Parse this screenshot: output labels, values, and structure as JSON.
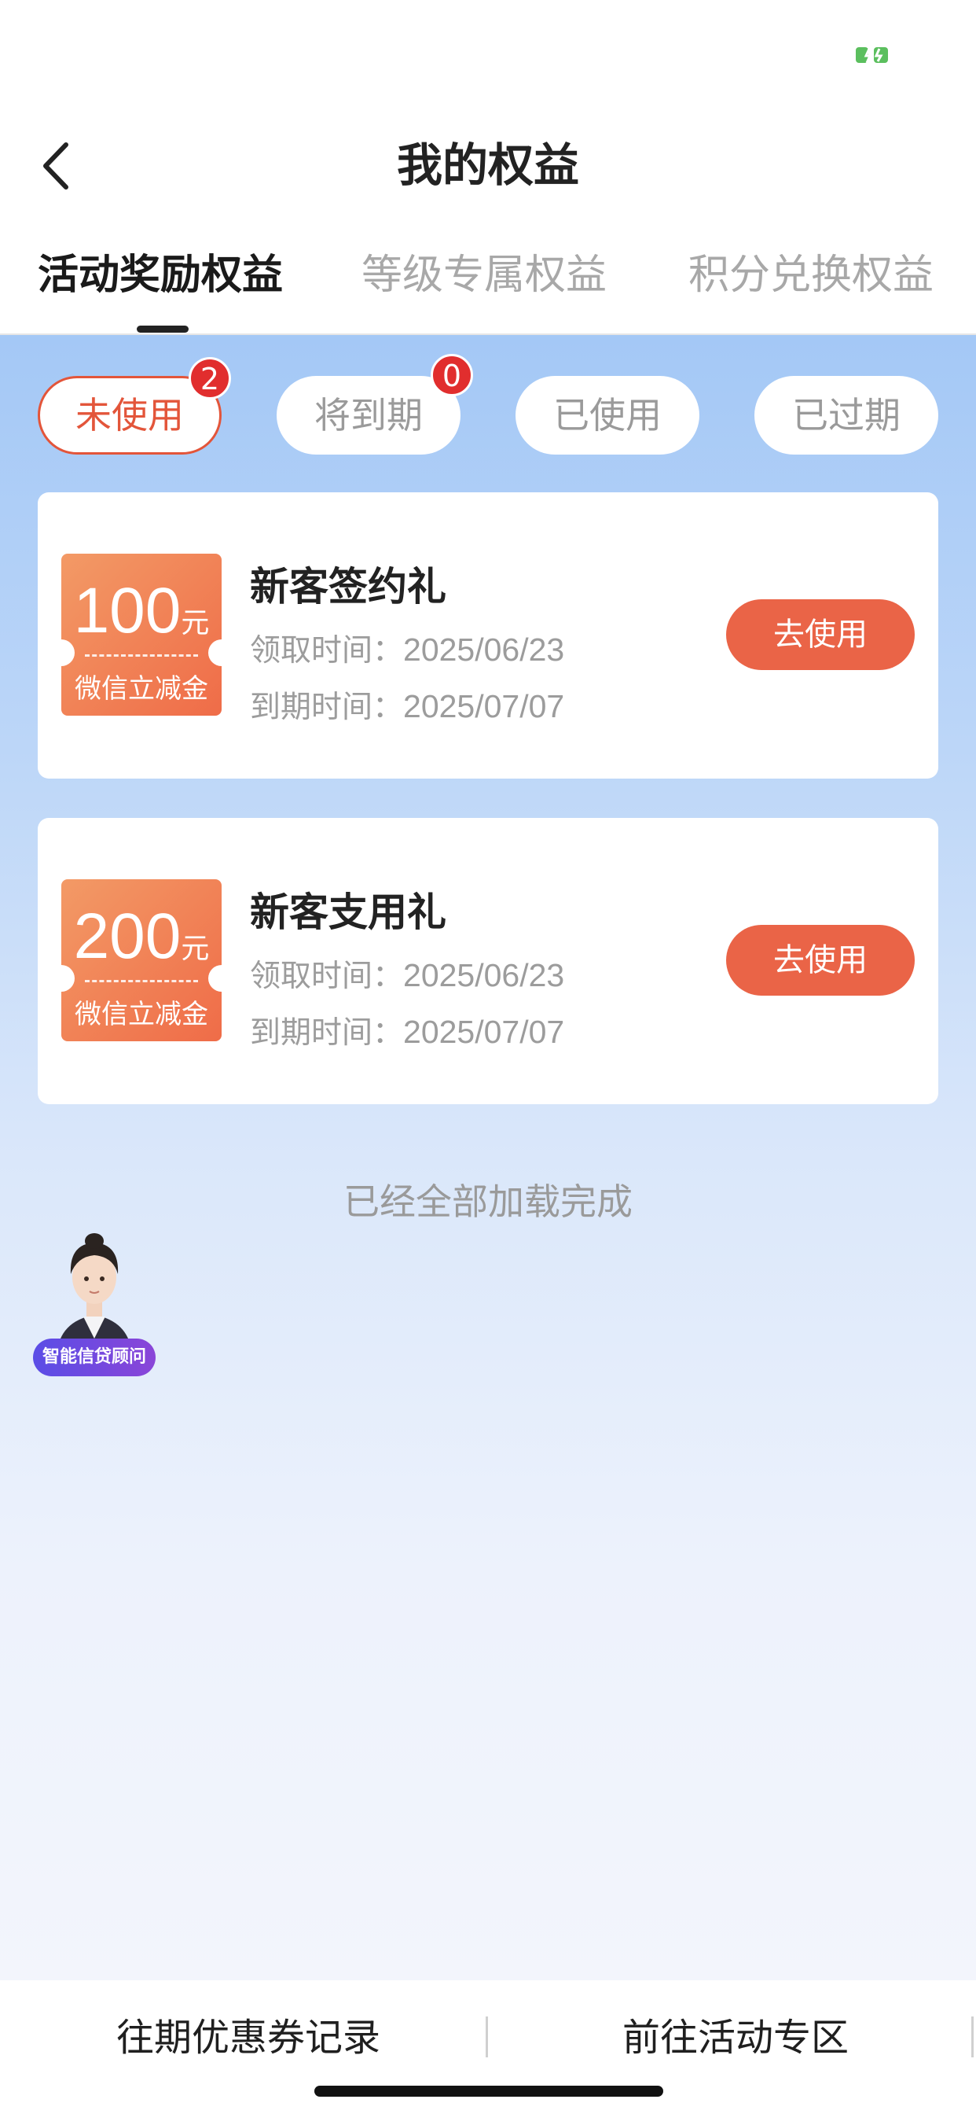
{
  "status_bar": {
    "battery_color": "#5bbf5e"
  },
  "nav": {
    "title": "我的权益",
    "back_icon": "chevron-left-icon"
  },
  "tabs": [
    {
      "label": "活动奖励权益",
      "active": true
    },
    {
      "label": "等级专属权益",
      "active": false
    },
    {
      "label": "积分兑换权益",
      "active": false
    }
  ],
  "filters": [
    {
      "label": "未使用",
      "badge": "2",
      "active": true
    },
    {
      "label": "将到期",
      "badge": "0",
      "active": false
    },
    {
      "label": "已使用",
      "badge": null,
      "active": false
    },
    {
      "label": "已过期",
      "badge": null,
      "active": false
    }
  ],
  "coupons": [
    {
      "amount": "100",
      "unit": "元",
      "type": "微信立减金",
      "title": "新客签约礼",
      "claim_label": "领取时间：",
      "claim_date": "2025/06/23",
      "expire_label": "到期时间：",
      "expire_date": "2025/07/07",
      "button": "去使用"
    },
    {
      "amount": "200",
      "unit": "元",
      "type": "微信立减金",
      "title": "新客支用礼",
      "claim_label": "领取时间：",
      "claim_date": "2025/06/23",
      "expire_label": "到期时间：",
      "expire_date": "2025/07/07",
      "button": "去使用"
    }
  ],
  "loaded_text": "已经全部加载完成",
  "assistant": {
    "label": "智能信贷顾问"
  },
  "bottom": {
    "left": "往期优惠券记录",
    "right": "前往活动专区"
  },
  "colors": {
    "accent": "#e3553a",
    "button": "#ea6447",
    "badge": "#e12e2e"
  }
}
